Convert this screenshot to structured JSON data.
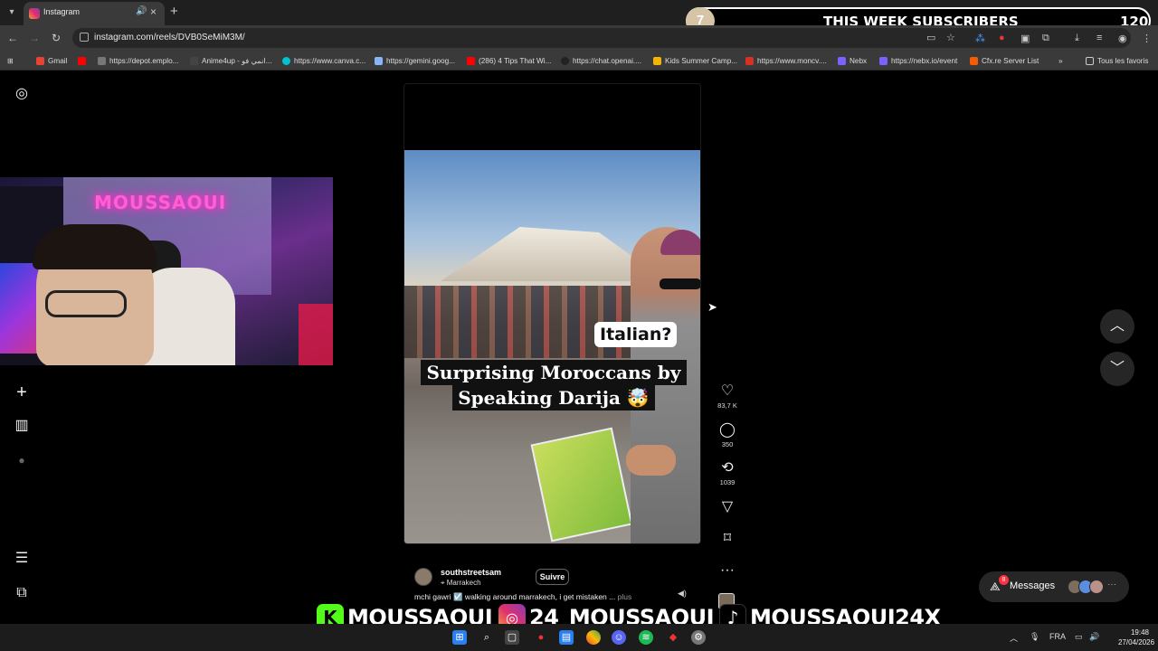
{
  "browser": {
    "tab_title": "Instagram",
    "url": "instagram.com/reels/DVB0SeMiM3M/",
    "bookmarks": [
      {
        "label": "Gmail",
        "color": "#ea4335"
      },
      {
        "label": "",
        "color": "#ff0000"
      },
      {
        "label": "https://depot.emplo...",
        "color": "#777777"
      },
      {
        "label": "Anime4up - انمي فو...",
        "color": "#444444"
      },
      {
        "label": "https://www.canva.c...",
        "color": "#00c4cc"
      },
      {
        "label": "https://gemini.goog...",
        "color": "#8ab4f8"
      },
      {
        "label": "(286) 4 Tips That Wi...",
        "color": "#ff0000"
      },
      {
        "label": "https://chat.openai....",
        "color": "#222222"
      },
      {
        "label": "Kids Summer Camp...",
        "color": "#f4b400"
      },
      {
        "label": "https://www.moncv....",
        "color": "#d93025"
      },
      {
        "label": "Nebx",
        "color": "#7b61ff"
      },
      {
        "label": "https://nebx.io/event",
        "color": "#7b61ff"
      },
      {
        "label": "Cfx.re Server List",
        "color": "#f25c05"
      }
    ],
    "all_bookmarks_label": "Tous les favoris"
  },
  "subs_overlay": {
    "circle_number": "7",
    "title": "THIS WEEK SUBSCRIBERS",
    "count": "120"
  },
  "webcam": {
    "sign_text": "MOUSSAOUI"
  },
  "reel": {
    "bubble_text": "Italian?",
    "caption_line1": "Surprising Moroccans by",
    "caption_line2": "Speaking Darija 🤯",
    "author": "southstreetsam",
    "location": "Marrakech",
    "follow_label": "Suivre",
    "post_caption": "mchi gawri ☑️ walking around marrakech, i get mistaken ...",
    "more_label": "plus",
    "likes": "83,7 K",
    "comments": "350",
    "reposts": "1039"
  },
  "messages": {
    "label": "Messages",
    "badge": "8"
  },
  "social": {
    "kick": "MOUSSAOUI",
    "instagram": "24_MOUSSAOUI",
    "tiktok": "MOUSSAOUI24X"
  },
  "taskbar": {
    "lang": "FRA",
    "time": "19:48",
    "date": "27/04/2026"
  }
}
